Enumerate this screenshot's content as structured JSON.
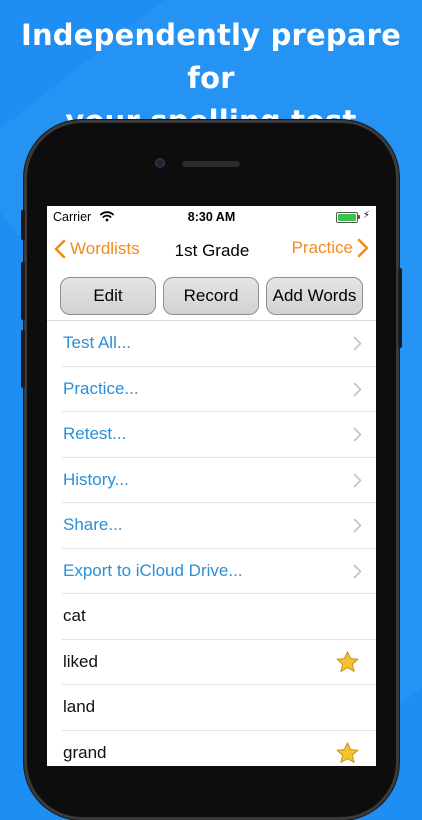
{
  "headline": {
    "line1": "Independently prepare for",
    "line2": "your spelling test"
  },
  "status_bar": {
    "carrier": "Carrier",
    "time": "8:30 AM"
  },
  "nav": {
    "back_label": "Wordlists",
    "title": "1st Grade",
    "forward_label": "Practice"
  },
  "toolbar": {
    "edit_label": "Edit",
    "record_label": "Record",
    "add_words_label": "Add Words"
  },
  "actions": [
    {
      "label": "Test All..."
    },
    {
      "label": "Practice..."
    },
    {
      "label": "Retest..."
    },
    {
      "label": "History..."
    },
    {
      "label": "Share..."
    },
    {
      "label": "Export to iCloud Drive..."
    }
  ],
  "words": [
    {
      "label": "cat",
      "starred": false
    },
    {
      "label": "liked",
      "starred": true
    },
    {
      "label": "land",
      "starred": false
    },
    {
      "label": "grand",
      "starred": true
    }
  ],
  "colors": {
    "background": "#1f8ef2",
    "accent_orange": "#f08c1c",
    "link_blue": "#2b8fd8",
    "battery_green": "#38c648"
  },
  "icons": {
    "back": "chevron-left-icon",
    "forward": "chevron-right-icon",
    "disclosure": "chevron-right-icon",
    "star": "star-icon",
    "wifi": "wifi-icon",
    "battery": "battery-icon",
    "charging": "bolt-icon"
  }
}
